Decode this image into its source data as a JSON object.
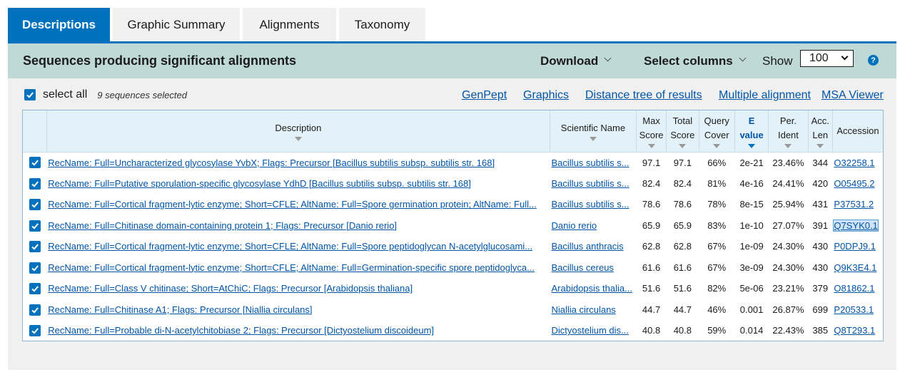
{
  "tabs": [
    "Descriptions",
    "Graphic Summary",
    "Alignments",
    "Taxonomy"
  ],
  "header": {
    "title": "Sequences producing significant alignments",
    "download_label": "Download",
    "select_columns_label": "Select columns",
    "show_label": "Show",
    "show_value": "100",
    "help_icon": "?"
  },
  "selection": {
    "select_all_label": "select all",
    "selected_count": "9 sequences selected"
  },
  "actions": [
    "GenPept",
    "Graphics",
    "Distance tree of results",
    "Multiple alignment",
    "MSA Viewer"
  ],
  "columns": {
    "description": "Description",
    "sci_name": "Scientific Name",
    "max_score": [
      "Max",
      "Score"
    ],
    "total_score": [
      "Total",
      "Score"
    ],
    "query_cover": [
      "Query",
      "Cover"
    ],
    "evalue": [
      "E",
      "value"
    ],
    "per_ident": [
      "Per.",
      "Ident"
    ],
    "acc_len": [
      "Acc.",
      "Len"
    ],
    "accession": "Accession"
  },
  "rows": [
    {
      "description": "RecName: Full=Uncharacterized glycosylase YvbX; Flags: Precursor [Bacillus subtilis subsp. subtilis str. 168]",
      "sci_name": "Bacillus subtilis s...",
      "max": "97.1",
      "total": "97.1",
      "cover": "66%",
      "evalue": "2e-21",
      "ident": "23.46%",
      "len": "344",
      "acc": "O32258.1"
    },
    {
      "description": "RecName: Full=Putative sporulation-specific glycosylase YdhD [Bacillus subtilis subsp. subtilis str. 168]",
      "sci_name": "Bacillus subtilis s...",
      "max": "82.4",
      "total": "82.4",
      "cover": "81%",
      "evalue": "4e-16",
      "ident": "24.41%",
      "len": "420",
      "acc": "O05495.2"
    },
    {
      "description": "RecName: Full=Cortical fragment-lytic enzyme; Short=CFLE; AltName: Full=Spore germination protein; AltName: Full...",
      "sci_name": "Bacillus subtilis s...",
      "max": "78.6",
      "total": "78.6",
      "cover": "78%",
      "evalue": "8e-15",
      "ident": "25.94%",
      "len": "431",
      "acc": "P37531.2"
    },
    {
      "description": "RecName: Full=Chitinase domain-containing protein 1; Flags: Precursor [Danio rerio]",
      "sci_name": "Danio rerio",
      "max": "65.9",
      "total": "65.9",
      "cover": "83%",
      "evalue": "1e-10",
      "ident": "27.07%",
      "len": "391",
      "acc": "Q7SYK0.1"
    },
    {
      "description": "RecName: Full=Cortical fragment-lytic enzyme; Short=CFLE; AltName: Full=Spore peptidoglycan N-acetylglucosami...",
      "sci_name": "Bacillus anthracis",
      "max": "62.8",
      "total": "62.8",
      "cover": "67%",
      "evalue": "1e-09",
      "ident": "24.30%",
      "len": "430",
      "acc": "P0DPJ9.1"
    },
    {
      "description": "RecName: Full=Cortical fragment-lytic enzyme; Short=CFLE; AltName: Full=Germination-specific spore peptidoglyca...",
      "sci_name": "Bacillus cereus",
      "max": "61.6",
      "total": "61.6",
      "cover": "67%",
      "evalue": "3e-09",
      "ident": "24.30%",
      "len": "430",
      "acc": "Q9K3E4.1"
    },
    {
      "description": "RecName: Full=Class V chitinase; Short=AtChiC; Flags: Precursor [Arabidopsis thaliana]",
      "sci_name": "Arabidopsis thalia...",
      "max": "51.6",
      "total": "51.6",
      "cover": "82%",
      "evalue": "5e-06",
      "ident": "23.21%",
      "len": "379",
      "acc": "O81862.1"
    },
    {
      "description": "RecName: Full=Chitinase A1; Flags: Precursor [Niallia circulans]",
      "sci_name": "Niallia circulans",
      "max": "44.7",
      "total": "44.7",
      "cover": "46%",
      "evalue": "0.001",
      "ident": "26.87%",
      "len": "699",
      "acc": "P20533.1"
    },
    {
      "description": "RecName: Full=Probable di-N-acetylchitobiase 2; Flags: Precursor [Dictyostelium discoideum]",
      "sci_name": "Dictyostelium dis...",
      "max": "40.8",
      "total": "40.8",
      "cover": "59%",
      "evalue": "0.014",
      "ident": "22.43%",
      "len": "385",
      "acc": "Q8T293.1"
    }
  ],
  "highlighted_accession": "Q7SYK0.1",
  "colors": {
    "accent": "#0071bc",
    "header_bar": "#bfd9d6",
    "link": "#0054a6"
  }
}
